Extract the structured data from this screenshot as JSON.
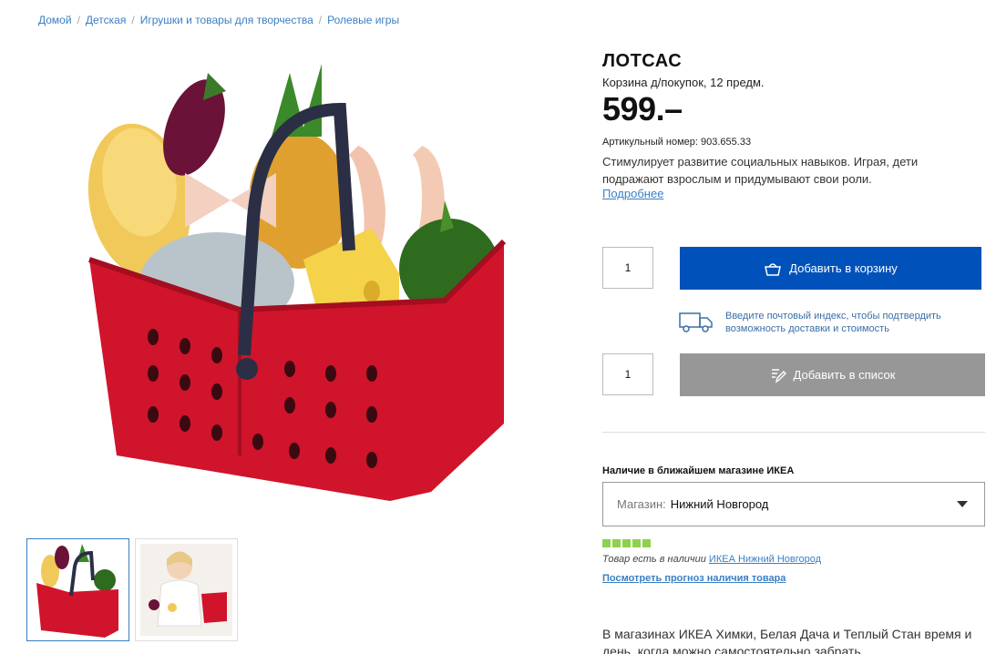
{
  "breadcrumb": {
    "items": [
      "Домой",
      "Детская",
      "Игрушки и товары для творчества",
      "Ролевые игры"
    ],
    "separator": "/"
  },
  "product": {
    "name": "ЛОТСАС",
    "description": "Корзина д/покупок, 12 предм.",
    "price": "599.–",
    "article_number": "Артикульный номер: 903.655.33",
    "summary": "Стимулирует развитие социальных навыков. Играя, дети подражают взрослым и придумывают свои роли.",
    "more_link": "Подробнее"
  },
  "purchase": {
    "quantity": "1",
    "add_to_cart": "Добавить в корзину",
    "delivery_text": "Введите почтовый индекс, чтобы подтвердить возможность доставки и стоимость",
    "list_quantity": "1",
    "add_to_list": "Добавить в список"
  },
  "availability": {
    "heading": "Наличие в ближайшем магазине ИКЕА",
    "store_label": "Магазин:",
    "store_value": "Нижний Новгород",
    "stock_level": 1.0,
    "stock_text": "Товар есть в наличии",
    "stock_store": "ИКЕА Нижний Новгород",
    "forecast_link": "Посмотреть прогноз наличия товара",
    "store_note": "В магазинах ИКЕА Химки, Белая Дача и Теплый Стан время и день, когда можно самостоятельно забрать"
  },
  "colors": {
    "accent_blue": "#0051ba",
    "link_blue": "#3a7fc4",
    "basket_red": "#d0142c",
    "stock_green": "#8fd14f",
    "button_gray": "#979797"
  }
}
